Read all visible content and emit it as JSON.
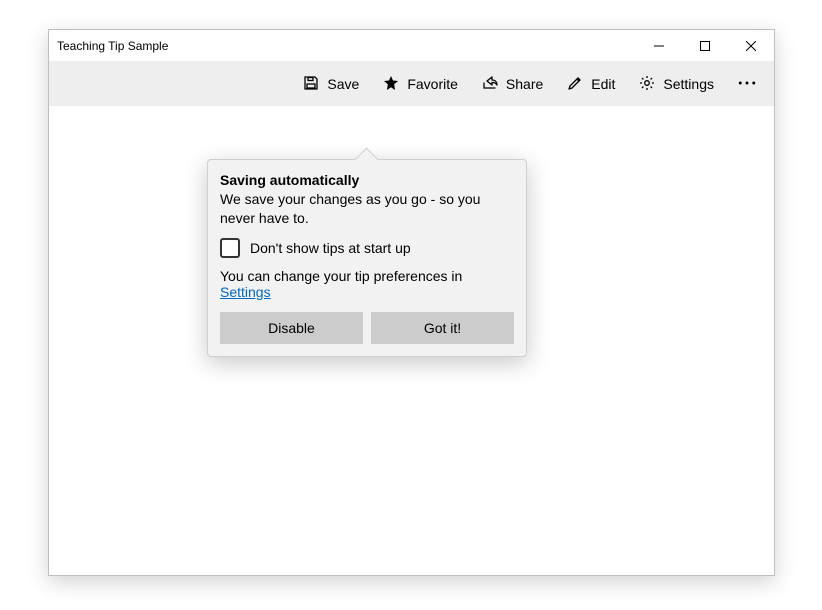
{
  "window": {
    "title": "Teaching Tip Sample"
  },
  "toolbar": {
    "save_label": "Save",
    "favorite_label": "Favorite",
    "share_label": "Share",
    "edit_label": "Edit",
    "settings_label": "Settings"
  },
  "tip": {
    "title": "Saving automatically",
    "body": "We save your changes as you go - so you never have to.",
    "checkbox_label": "Don't show tips at start up",
    "footer_prefix": "You can change your tip preferences in ",
    "footer_link": "Settings",
    "button_close": "Disable",
    "button_action": "Got it!"
  }
}
